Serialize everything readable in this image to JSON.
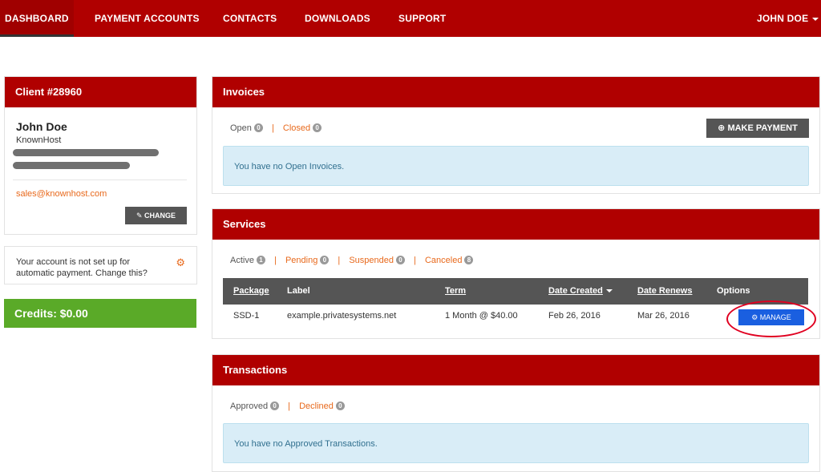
{
  "nav": {
    "items": [
      "DASHBOARD",
      "PAYMENT ACCOUNTS",
      "CONTACTS",
      "DOWNLOADS",
      "SUPPORT"
    ],
    "user": "JOHN DOE"
  },
  "client": {
    "title": "Client #28960",
    "name": "John Doe",
    "company": "KnownHost",
    "email": "sales@knownhost.com",
    "change_label": "CHANGE"
  },
  "autopay": {
    "text": "Your account is not set up for automatic payment. Change this?"
  },
  "credits": {
    "label": "Credits: $0.00"
  },
  "invoices": {
    "title": "Invoices",
    "filters": [
      {
        "label": "Open",
        "count": "0"
      },
      {
        "label": "Closed",
        "count": "0"
      }
    ],
    "make_payment": "MAKE PAYMENT",
    "empty": "You have no Open Invoices."
  },
  "services": {
    "title": "Services",
    "filters": [
      {
        "label": "Active",
        "count": "1"
      },
      {
        "label": "Pending",
        "count": "0"
      },
      {
        "label": "Suspended",
        "count": "0"
      },
      {
        "label": "Canceled",
        "count": "8"
      }
    ],
    "columns": [
      "Package",
      "Label",
      "Term",
      "Date Created",
      "Date Renews",
      "Options"
    ],
    "row": {
      "package": "SSD-1",
      "label": "example.privatesystems.net",
      "term": "1 Month @ $40.00",
      "created": "Feb 26, 2016",
      "renews": "Mar 26, 2016",
      "action": "MANAGE"
    }
  },
  "transactions": {
    "title": "Transactions",
    "filters": [
      {
        "label": "Approved",
        "count": "0"
      },
      {
        "label": "Declined",
        "count": "0"
      }
    ],
    "empty": "You have no Approved Transactions."
  },
  "colors": {
    "brand_red": "#b00000",
    "accent_orange": "#e8691c",
    "credits_green": "#5aaa28",
    "manage_blue": "#1a5fe0"
  }
}
